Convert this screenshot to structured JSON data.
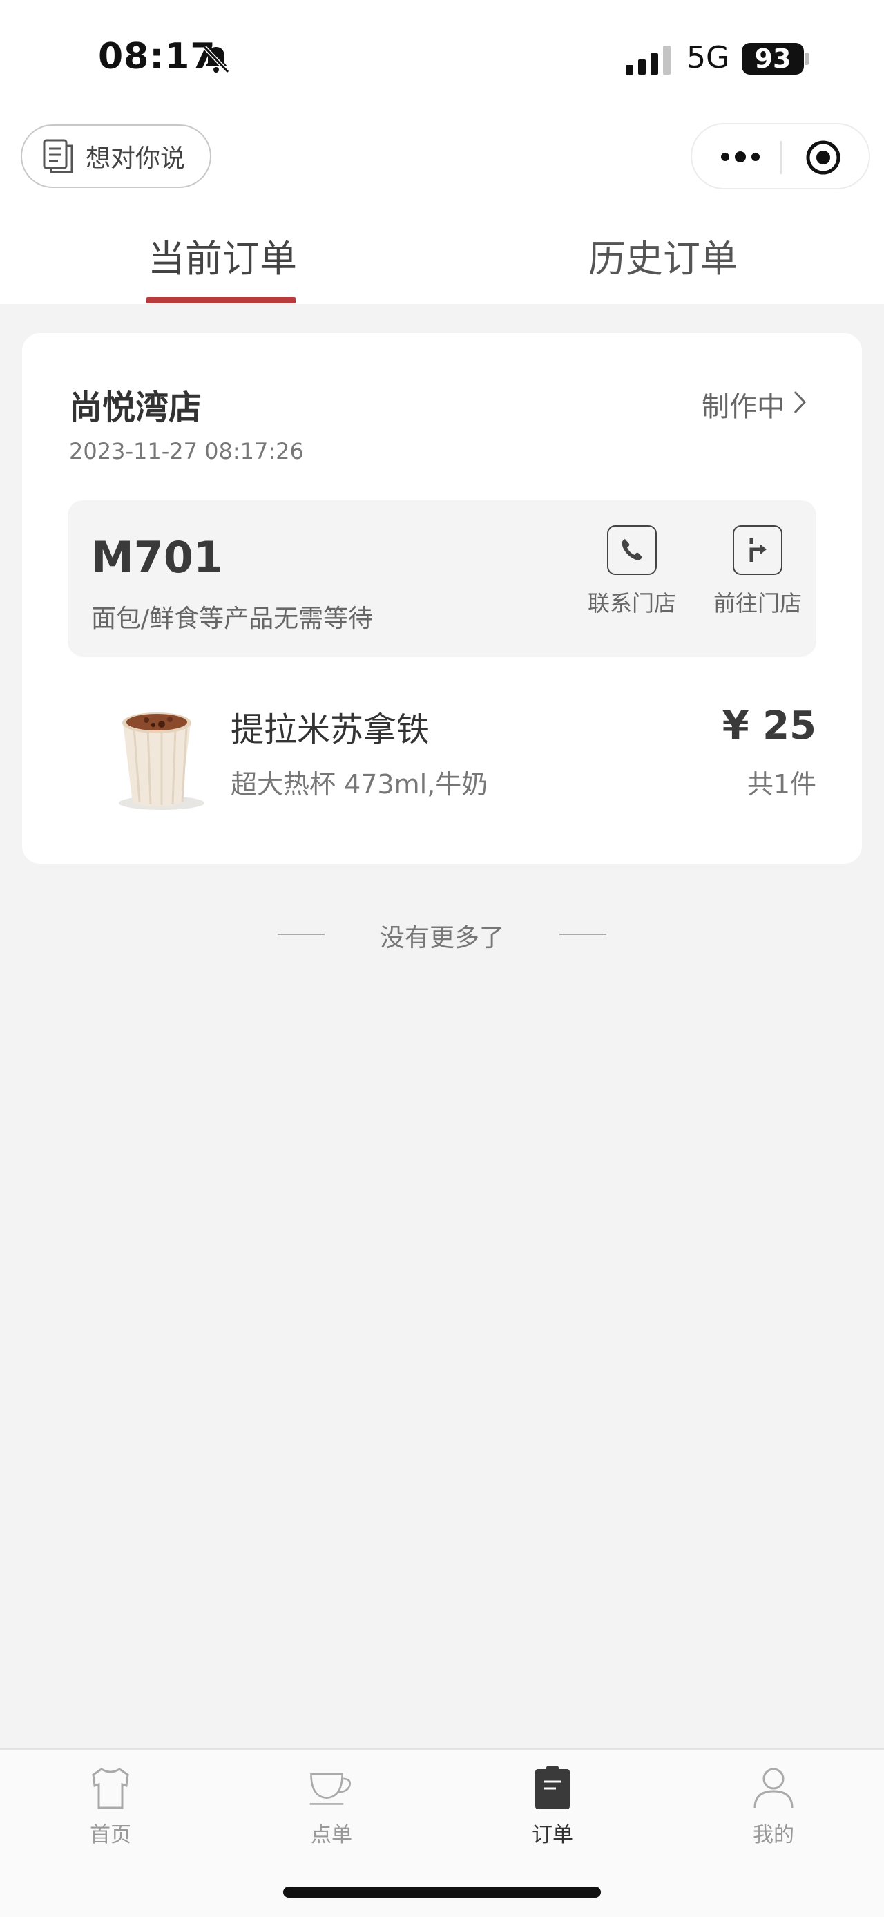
{
  "status_bar": {
    "time": "08:17",
    "network": "5G",
    "battery": "93",
    "icons": [
      "bell-muted-icon",
      "signal-icon"
    ]
  },
  "header": {
    "feedback_label": "想对你说",
    "feedback_icon": "document-icon",
    "capsule_icons": [
      "more-icon",
      "target-icon"
    ]
  },
  "tabs": [
    {
      "label": "当前订单",
      "active": true
    },
    {
      "label": "历史订单",
      "active": false
    }
  ],
  "colors": {
    "accent": "#b83a3c",
    "background": "#f3f3f3",
    "card": "#ffffff"
  },
  "order": {
    "store_name": "尚悦湾店",
    "created_at": "2023-11-27 08:17:26",
    "status": "制作中",
    "pickup_code": "M701",
    "pickup_note": "面包/鲜食等产品无需等待",
    "actions": [
      {
        "label": "联系门店",
        "icon": "phone-icon"
      },
      {
        "label": "前往门店",
        "icon": "directions-icon"
      }
    ],
    "items": [
      {
        "name": "提拉米苏拿铁",
        "spec": "超大热杯 473ml,牛奶",
        "price": "¥ 25",
        "quantity": "共1件"
      }
    ]
  },
  "list_end_text": "没有更多了",
  "bottom_nav": [
    {
      "label": "首页",
      "icon": "tshirt-icon",
      "active": false
    },
    {
      "label": "点单",
      "icon": "coffee-cup-icon",
      "active": false
    },
    {
      "label": "订单",
      "icon": "clipboard-icon",
      "active": true
    },
    {
      "label": "我的",
      "icon": "user-icon",
      "active": false
    }
  ]
}
